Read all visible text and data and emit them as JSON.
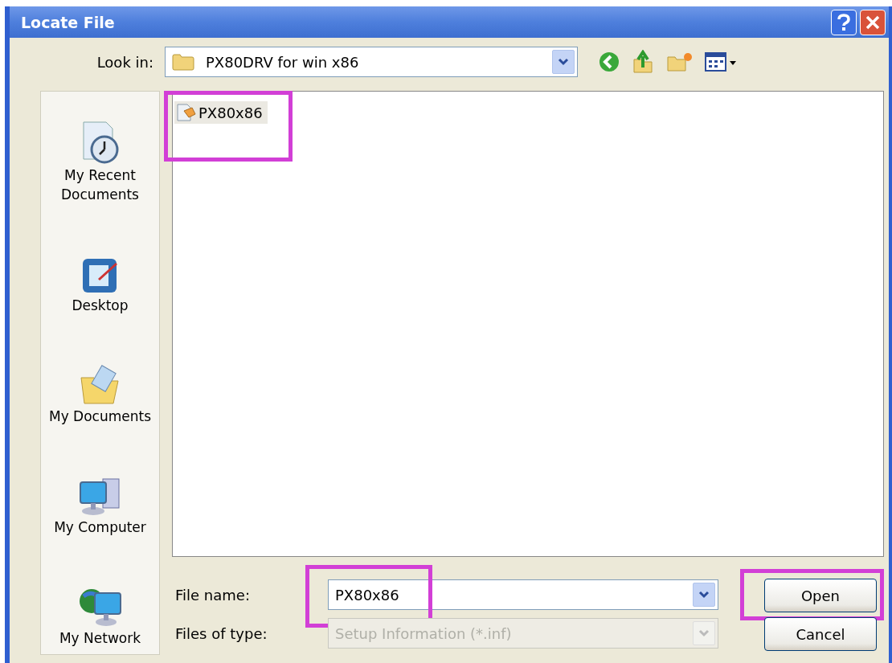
{
  "window": {
    "title": "Locate File"
  },
  "look_in": {
    "label": "Look in:",
    "value": "PX80DRV for win x86"
  },
  "places": [
    {
      "kind": "recent",
      "label": "My Recent\nDocuments"
    },
    {
      "kind": "desktop",
      "label": "Desktop"
    },
    {
      "kind": "documents",
      "label": "My Documents"
    },
    {
      "kind": "computer",
      "label": "My Computer"
    },
    {
      "kind": "network",
      "label": "My Network"
    }
  ],
  "files": [
    {
      "name": "PX80x86",
      "selected": true,
      "highlighted": true
    }
  ],
  "file_name": {
    "label": "File name:",
    "value": "PX80x86",
    "highlighted": true
  },
  "files_of_type": {
    "label": "Files of type:",
    "value": "Setup Information (*.inf)",
    "disabled": true
  },
  "buttons": [
    {
      "label": "Open",
      "highlighted": true
    },
    {
      "label": "Cancel",
      "highlighted": false
    }
  ]
}
